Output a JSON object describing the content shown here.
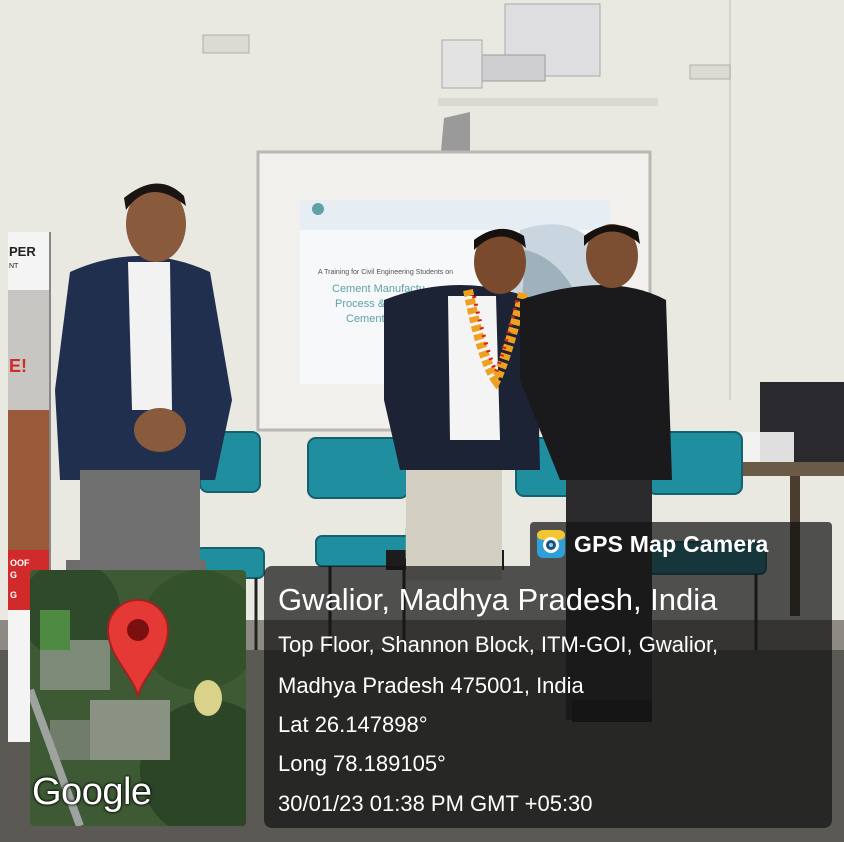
{
  "overlay": {
    "app_name": "GPS Map Camera",
    "app_icon": "gps-map-camera-icon",
    "location_title": "Gwalior, Madhya Pradesh, India",
    "address_line_1": "Top Floor, Shannon Block, ITM-GOI, Gwalior,",
    "address_line_2": "Madhya Pradesh 475001, India",
    "latitude": "Lat 26.147898°",
    "longitude": "Long 78.189105°",
    "timestamp": "30/01/23 01:38 PM GMT +05:30",
    "map_watermark": "Google",
    "map_pin_icon": "map-pin-icon",
    "pin_color": "#e53935"
  },
  "scene": {
    "slide_lines": [
      "A Training for Civil Engineering Students on",
      "Cement Manufactu",
      "Process & Guida",
      "Cement Sele"
    ],
    "banner_text": [
      "PER",
      "NT",
      "E!",
      "OOF",
      "G",
      "G"
    ],
    "colors": {
      "wall": "#ecebe4",
      "chair_seat": "#1f8fa0",
      "slide_text": "#5ea1a6"
    }
  }
}
